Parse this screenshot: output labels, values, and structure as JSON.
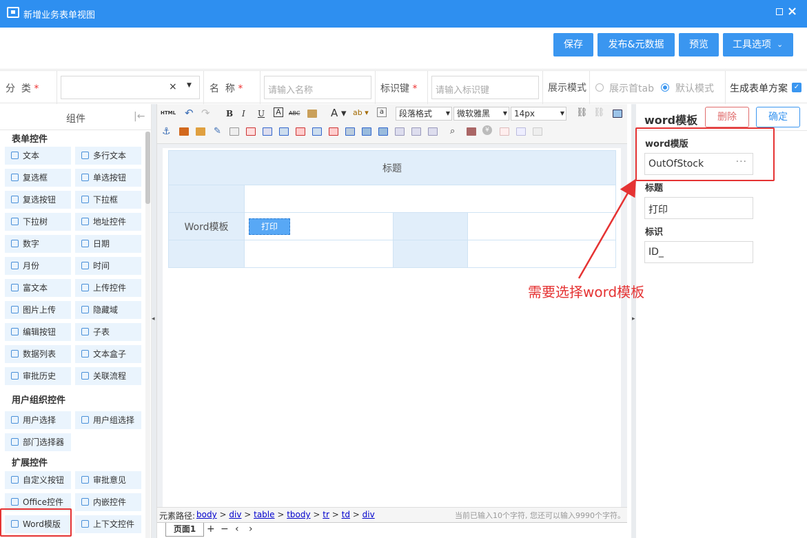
{
  "window": {
    "title": "新增业务表单视图"
  },
  "actions": {
    "save": "保存",
    "publish": "发布&元数据",
    "preview": "预览",
    "tools": "工具选项"
  },
  "form": {
    "category_label": "分  类",
    "category_req": "*",
    "category_clear": "×",
    "name_label": "名  称",
    "name_req": "*",
    "name_placeholder": "请输入名称",
    "key_label": "标识键",
    "key_req": "*",
    "key_placeholder": "请输入标识键",
    "display_label": "展示模式",
    "display_opt1": "展示首tab",
    "display_opt2": "默认模式",
    "gen_label": "生成表单方案"
  },
  "left_panel": {
    "title": "组件",
    "sections": [
      {
        "title": "表单控件",
        "items": [
          "文本",
          "多行文本",
          "复选框",
          "单选按钮",
          "复选按钮",
          "下拉框",
          "下拉树",
          "地址控件",
          "数字",
          "日期",
          "月份",
          "时间",
          "富文本",
          "上传控件",
          "图片上传",
          "隐藏域",
          "编辑按钮",
          "子表",
          "数据列表",
          "文本盒子",
          "审批历史",
          "关联流程"
        ]
      },
      {
        "title": "用户组织控件",
        "items": [
          "用户选择",
          "用户组选择",
          "部门选择器"
        ]
      },
      {
        "title": "扩展控件",
        "items": [
          "自定义按钮",
          "审批意见",
          "Office控件",
          "内嵌控件",
          "Word模版",
          "上下文控件"
        ]
      }
    ]
  },
  "toolbar": {
    "html": "HTML",
    "paragraph": "段落格式",
    "font": "微软雅黑",
    "size": "14px"
  },
  "canvas": {
    "table_title": "标题",
    "row_label": "Word模板",
    "print_btn": "打印"
  },
  "pathbar": {
    "label": "元素路径:",
    "crumbs": [
      "body",
      "div",
      "table",
      "tbody",
      "tr",
      "td",
      "div"
    ],
    "count": "当前已输入10个字符, 您还可以输入9990个字符。"
  },
  "tabs": {
    "page1": "页面1",
    "add": "+",
    "remove": "−",
    "prev": "‹",
    "next": "›"
  },
  "right_panel": {
    "title": "word模板",
    "delete": "删除",
    "confirm": "确定",
    "fields": [
      {
        "label": "word模版",
        "value": "OutOfStock"
      },
      {
        "label": "标题",
        "value": "打印"
      },
      {
        "label": "标识",
        "value": "ID_"
      }
    ]
  },
  "annotation": {
    "text": "需要选择word模板",
    "color": "#e53333"
  },
  "colors": {
    "titlebar": "#2e8ff0",
    "button": "#3a96f0"
  }
}
